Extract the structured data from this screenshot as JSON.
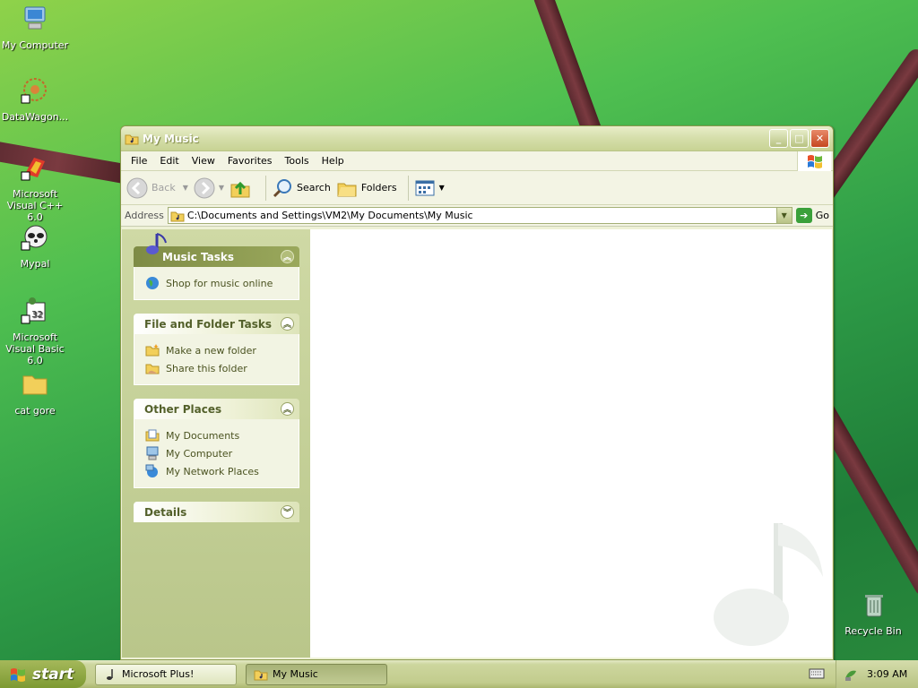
{
  "desktop": {
    "icons": [
      {
        "label": "My Computer"
      },
      {
        "label": "DataWagon..."
      },
      {
        "label": "Microsoft Visual C++ 6.0"
      },
      {
        "label": "Mypal"
      },
      {
        "label": "Microsoft Visual Basic 6.0"
      },
      {
        "label": "cat gore"
      },
      {
        "label": "Recycle Bin"
      }
    ]
  },
  "window": {
    "title": "My Music",
    "menu": [
      "File",
      "Edit",
      "View",
      "Favorites",
      "Tools",
      "Help"
    ],
    "toolbar": {
      "back": "Back",
      "search": "Search",
      "folders": "Folders"
    },
    "address": {
      "label": "Address",
      "value": "C:\\Documents and Settings\\VM2\\My Documents\\My Music",
      "go": "Go"
    },
    "taskpane": {
      "music_tasks": {
        "title": "Music Tasks",
        "items": [
          "Shop for music online"
        ]
      },
      "file_folder_tasks": {
        "title": "File and Folder Tasks",
        "items": [
          "Make a new folder",
          "Share this folder"
        ]
      },
      "other_places": {
        "title": "Other Places",
        "items": [
          "My Documents",
          "My Computer",
          "My Network Places"
        ]
      },
      "details": {
        "title": "Details"
      }
    }
  },
  "taskbar": {
    "start": "start",
    "buttons": [
      "Microsoft Plus!",
      "My Music"
    ],
    "clock": "3:09 AM"
  },
  "colors": {
    "accent": "#7d9a32",
    "pane": "#cfd9a5",
    "link": "#4a5220"
  }
}
